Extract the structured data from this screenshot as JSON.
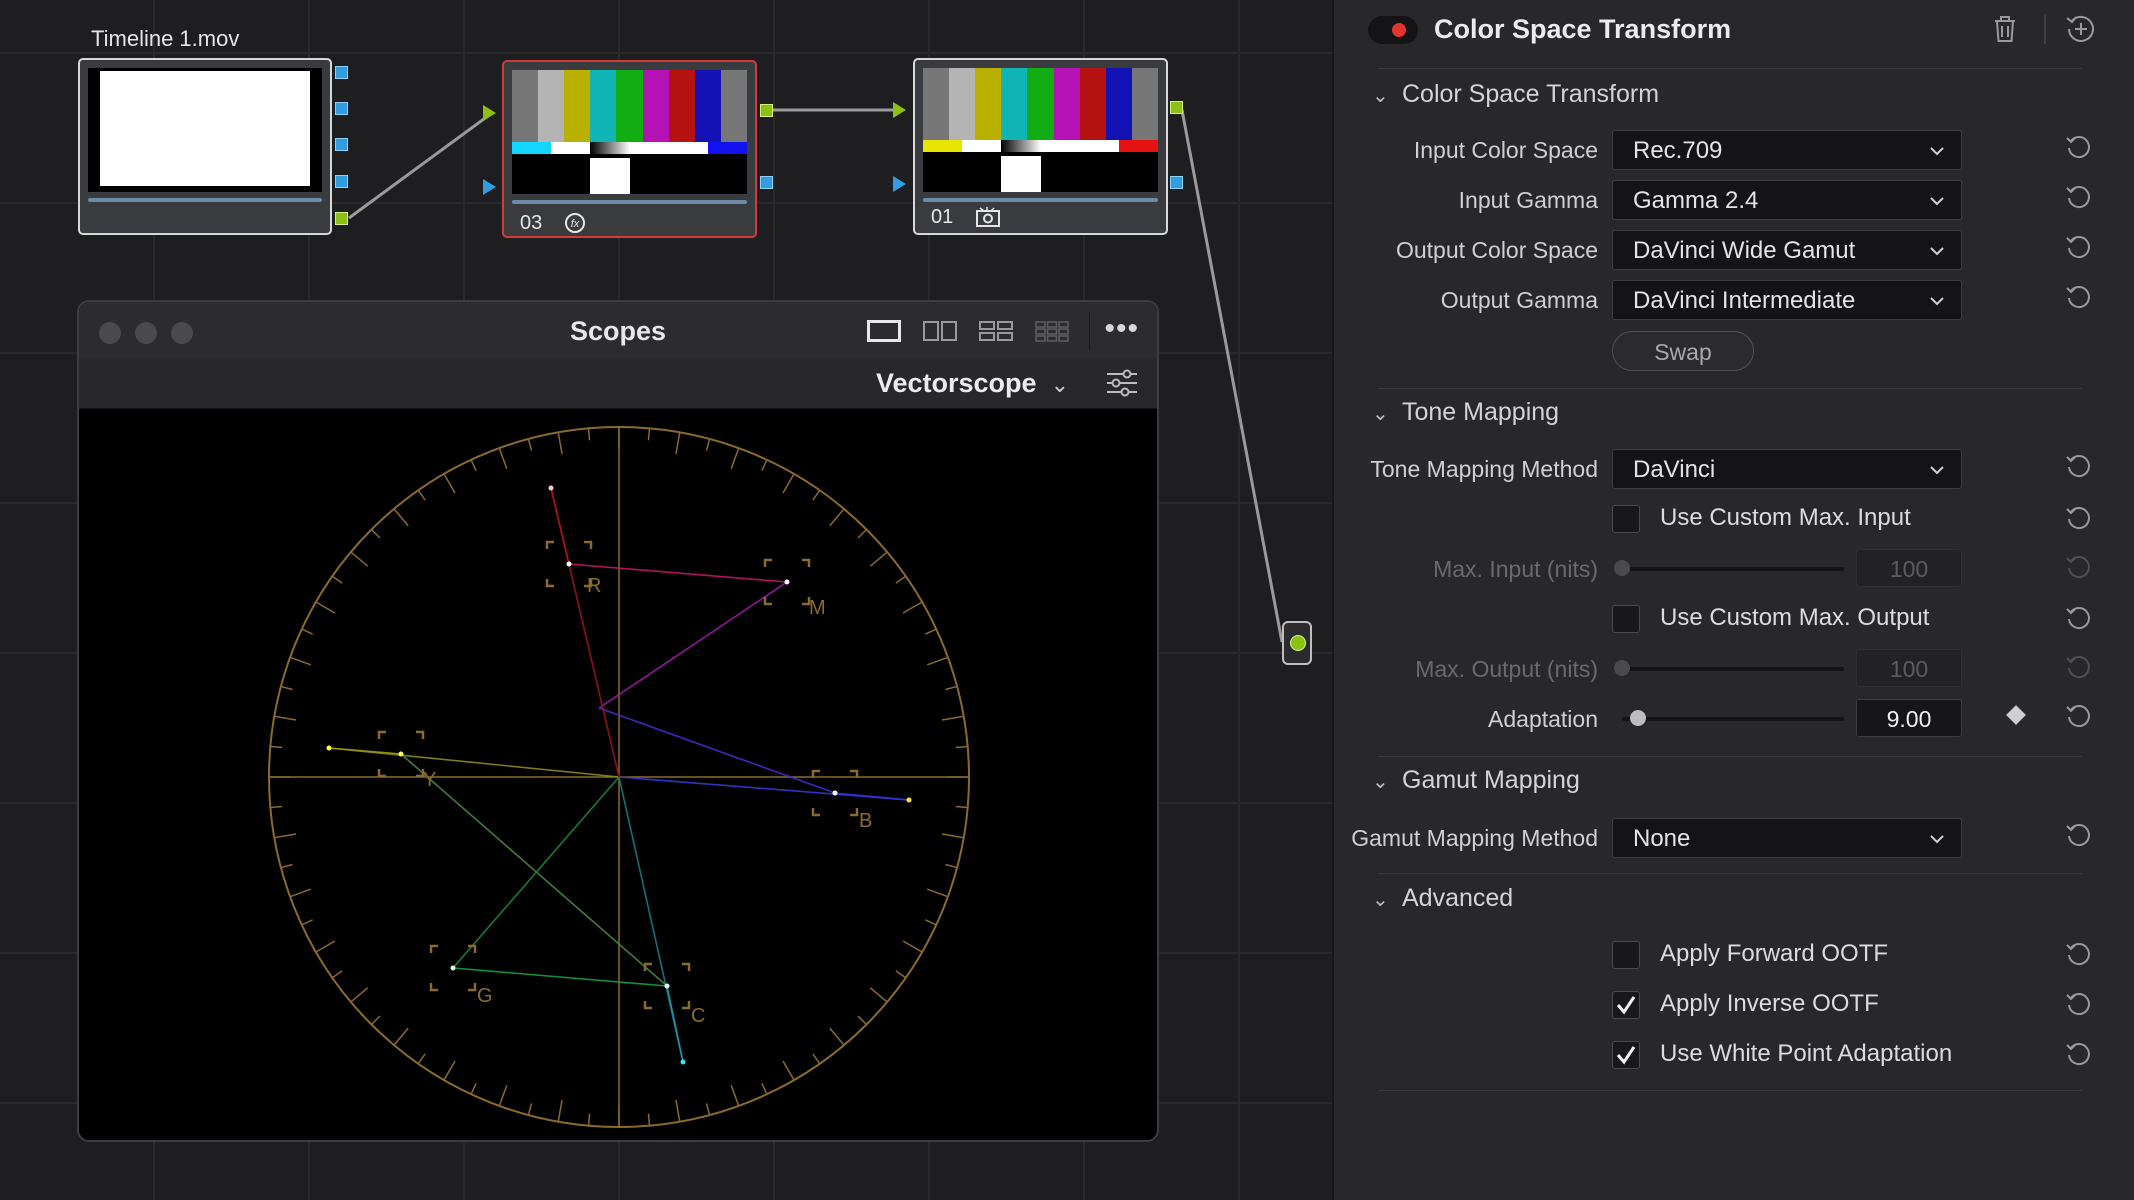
{
  "node_editor": {
    "clip_label": "Timeline 1.mov",
    "nodes": [
      {
        "number": "03",
        "icon": "fx-icon"
      },
      {
        "number": "01",
        "icon": "cache-icon"
      }
    ]
  },
  "scopes": {
    "title": "Scopes",
    "scope_type": "Vectorscope",
    "layouts": [
      "single-layout-icon",
      "dual-layout-icon",
      "quad-layout-icon",
      "grid-layout-icon"
    ],
    "more_label": "•••",
    "targets": [
      "R",
      "M",
      "Y",
      "B",
      "G",
      "C"
    ]
  },
  "inspector": {
    "title": "Color Space Transform",
    "sections": {
      "cst": "Color Space Transform",
      "tone": "Tone Mapping",
      "gamut": "Gamut Mapping",
      "advanced": "Advanced"
    },
    "input_color_space": {
      "label": "Input Color Space",
      "value": "Rec.709"
    },
    "input_gamma": {
      "label": "Input Gamma",
      "value": "Gamma 2.4"
    },
    "output_color_space": {
      "label": "Output Color Space",
      "value": "DaVinci Wide Gamut"
    },
    "output_gamma": {
      "label": "Output Gamma",
      "value": "DaVinci Intermediate"
    },
    "swap_label": "Swap",
    "tone_method": {
      "label": "Tone Mapping Method",
      "value": "DaVinci"
    },
    "custom_max_input": {
      "label": "Use Custom Max. Input",
      "checked": false
    },
    "max_input": {
      "label": "Max. Input (nits)",
      "value": "100"
    },
    "custom_max_output": {
      "label": "Use Custom Max. Output",
      "checked": false
    },
    "max_output": {
      "label": "Max. Output (nits)",
      "value": "100"
    },
    "adaptation": {
      "label": "Adaptation",
      "value": "9.00"
    },
    "gamut_method": {
      "label": "Gamut Mapping Method",
      "value": "None"
    },
    "apply_forward_ootf": {
      "label": "Apply Forward OOTF",
      "checked": false
    },
    "apply_inverse_ootf": {
      "label": "Apply Inverse OOTF",
      "checked": true
    },
    "white_point_adaptation": {
      "label": "Use White Point Adaptation",
      "checked": true
    }
  },
  "colors": {
    "accent_red": "#e2342d",
    "port_green": "#8cc014",
    "port_blue": "#2f9de0",
    "graticule": "#8a6a2e"
  }
}
